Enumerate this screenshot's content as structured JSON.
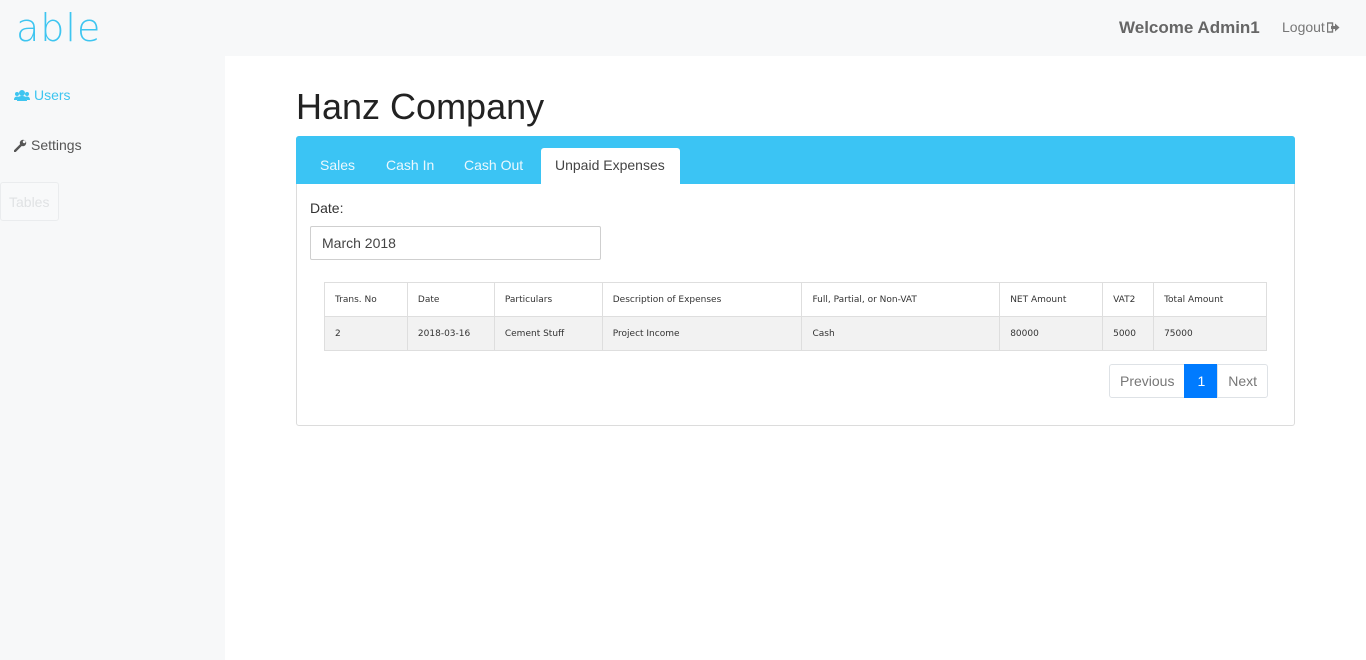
{
  "header": {
    "logo": "able",
    "welcome": "Welcome Admin1",
    "logout": "Logout"
  },
  "sidebar": {
    "items": [
      {
        "label": "Users",
        "icon": "users-icon",
        "active": true
      },
      {
        "label": "Settings",
        "icon": "wrench-icon"
      }
    ],
    "tables_button": "Tables"
  },
  "main": {
    "title": "Hanz Company",
    "tabs": [
      {
        "label": "Sales"
      },
      {
        "label": "Cash In"
      },
      {
        "label": "Cash Out"
      },
      {
        "label": "Unpaid Expenses",
        "active": true
      }
    ],
    "date_label": "Date:",
    "date_value": "March 2018"
  },
  "table": {
    "headers": [
      "Trans. No",
      "Date",
      "Particulars",
      "Description of Expenses",
      "Full, Partial, or Non-VAT",
      "NET Amount",
      "VAT2",
      "Total Amount"
    ],
    "rows": [
      [
        "2",
        "2018-03-16",
        "Cement Stuff",
        "Project Income",
        "Cash",
        "80000",
        "5000",
        "75000"
      ]
    ]
  },
  "pagination": {
    "previous": "Previous",
    "current": "1",
    "next": "Next"
  },
  "colors": {
    "accent": "#3bc4f4",
    "active_page": "#007bff",
    "sidebar_bg": "#f7f8f9"
  }
}
